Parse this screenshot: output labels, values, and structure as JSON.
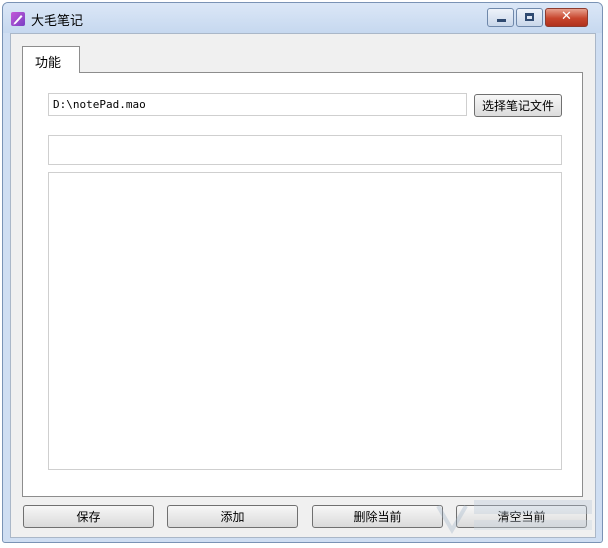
{
  "window": {
    "title": "大毛笔记",
    "controls": [
      "minimize-icon",
      "maximize-icon",
      "close-icon"
    ]
  },
  "tabs": [
    {
      "label": "功能",
      "active": true
    }
  ],
  "file_path": {
    "value": "D:\\notePad.mao"
  },
  "select_file_button": "选择笔记文件",
  "note_title": {
    "value": ""
  },
  "note_content": {
    "value": ""
  },
  "buttons": {
    "save": "保存",
    "add": "添加",
    "delete_current": "删除当前",
    "clear_current": "清空当前"
  },
  "colors": {
    "titlebar": "#cfdef2",
    "close_button": "#c7452c"
  }
}
